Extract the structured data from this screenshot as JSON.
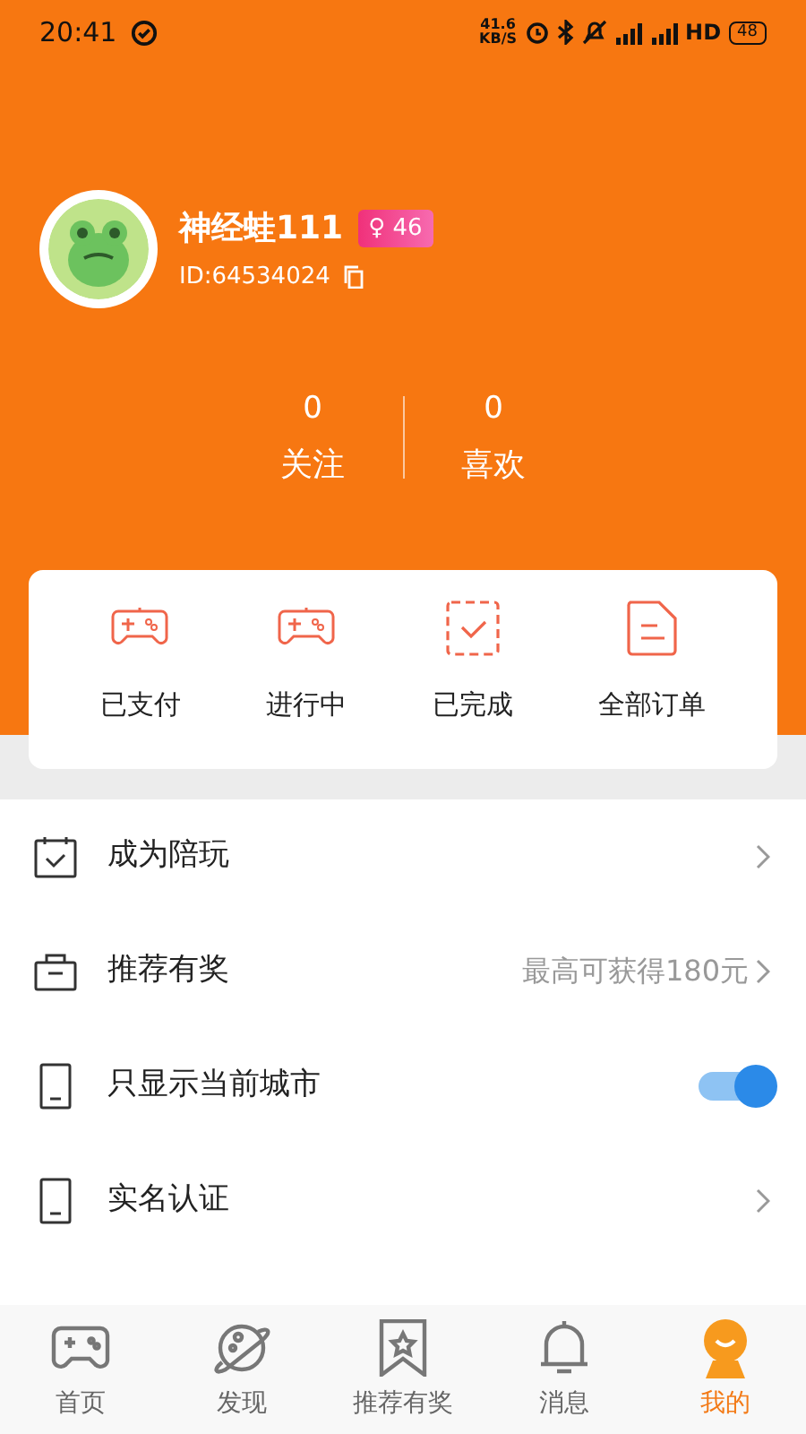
{
  "status_bar": {
    "time": "20:41",
    "speed": "41.6",
    "speed_unit": "KB/S",
    "network": "HD",
    "battery": "48"
  },
  "profile": {
    "name": "神经蛙111",
    "gender": "♀",
    "age": "46",
    "id": "ID:64534024"
  },
  "stats": [
    {
      "value": "0",
      "label": "关注"
    },
    {
      "value": "0",
      "label": "喜欢"
    }
  ],
  "orders": [
    {
      "label": "已支付"
    },
    {
      "label": "进行中"
    },
    {
      "label": "已完成"
    },
    {
      "label": "全部订单"
    }
  ],
  "menu": [
    {
      "kind": "link",
      "label": "成为陪玩"
    },
    {
      "kind": "hint",
      "label": "推荐有奖",
      "hint": "最高可获得180元"
    },
    {
      "kind": "toggle",
      "label": "只显示当前城市",
      "on": true
    },
    {
      "kind": "link",
      "label": "实名认证"
    }
  ],
  "tabs": [
    {
      "label": "首页",
      "selected": false
    },
    {
      "label": "发现",
      "selected": false
    },
    {
      "label": "推荐有奖",
      "selected": false
    },
    {
      "label": "消息",
      "selected": false
    },
    {
      "label": "我的",
      "selected": true
    }
  ]
}
